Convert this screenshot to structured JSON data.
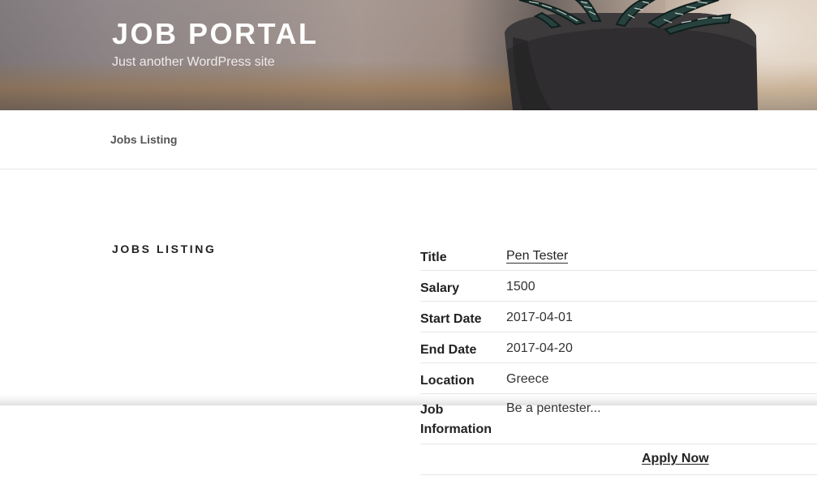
{
  "header": {
    "site_title": "JOB PORTAL",
    "tagline": "Just another WordPress site"
  },
  "nav": {
    "items": [
      {
        "label": "Jobs Listing"
      }
    ]
  },
  "main": {
    "section_title": "JOBS LISTING",
    "job": {
      "rows": [
        {
          "label": "Title",
          "value": "Pen Tester"
        },
        {
          "label": "Salary",
          "value": "1500"
        },
        {
          "label": "Start Date",
          "value": "2017-04-01"
        },
        {
          "label": "End Date",
          "value": "2017-04-20"
        },
        {
          "label": "Location",
          "value": "Greece"
        },
        {
          "label": "Job Information",
          "value": "Be a pentester..."
        }
      ],
      "apply_label": "Apply Now"
    }
  }
}
